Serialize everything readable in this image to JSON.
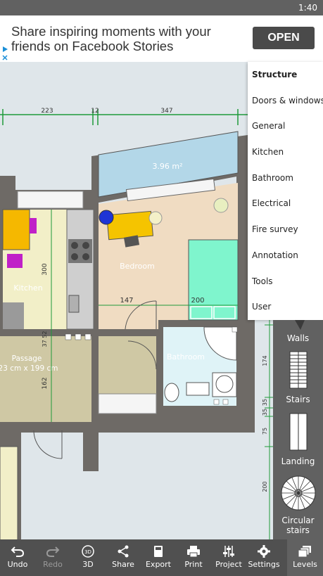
{
  "status": {
    "time": "1:40"
  },
  "ad": {
    "text": "Share inspiring moments with your friends on Facebook Stories",
    "cta": "OPEN"
  },
  "plan": {
    "dims_top": [
      "223",
      "12",
      "347"
    ],
    "area_label": "3.96 m²",
    "rooms": {
      "bedroom": "Bedroom",
      "kitchen": "Kitchen",
      "bathroom": "Bathroom",
      "passage": "Passage",
      "passage_size": "23 cm x 199 cm"
    },
    "measures": {
      "kitchen_v": "300",
      "bed_147": "147",
      "bed_200": "200",
      "small_v": "37 52",
      "passage_v": "162",
      "right_174": "174",
      "right_35a": "35",
      "right_35b": "35",
      "right_75": "75",
      "right_200": "200"
    }
  },
  "menu": {
    "items": [
      "Structure",
      "Doors & windows",
      "General",
      "Kitchen",
      "Bathroom",
      "Electrical",
      "Fire survey",
      "Annotation",
      "Tools",
      "User"
    ],
    "active": "Structure"
  },
  "panel": {
    "tools": [
      "Walls",
      "Stairs",
      "Landing",
      "Circular stairs"
    ]
  },
  "toolbar": {
    "undo": "Undo",
    "redo": "Redo",
    "threed": "3D",
    "share": "Share",
    "export": "Export",
    "print": "Print",
    "project": "Project",
    "settings": "Settings",
    "levels": "Levels"
  },
  "colors": {
    "wall": "#6e6a66",
    "bedroom_floor": "#f0dcc2",
    "kitchen_floor": "#f2efc8",
    "bathroom_floor": "#dff3f7",
    "passage_floor": "#cfc8a4",
    "balcony": "#b3d7e8",
    "bed": "#7ff5cd",
    "dimension": "#1f9a3a"
  }
}
